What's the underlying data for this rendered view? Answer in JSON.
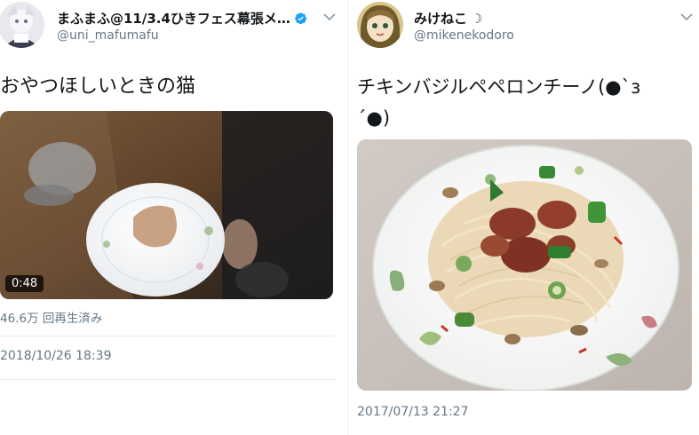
{
  "left_tweet": {
    "display_name": "まふまふ@11/3.4ひきフェス幕張メ…",
    "handle": "@uni_mafumafu",
    "text": "おやつほしいときの猫",
    "video_duration": "0:48",
    "views": "46.6万 回再生済み",
    "timestamp": "2018/10/26 18:39"
  },
  "right_tweet": {
    "display_name": "みけねこ",
    "name_emoji": "☽",
    "handle": "@mikenekodoro",
    "text_line1": "チキンバジルペペロンチーノ(●`з",
    "text_line2": "´●)",
    "timestamp": "2017/07/13 21:27"
  },
  "colors": {
    "text_primary": "#14171a",
    "text_secondary": "#657786",
    "verified_blue": "#1da1f2",
    "divider": "#e6ecf0"
  },
  "icons": [
    "verified-badge-icon",
    "chevron-down-icon",
    "chevron-down-icon"
  ]
}
